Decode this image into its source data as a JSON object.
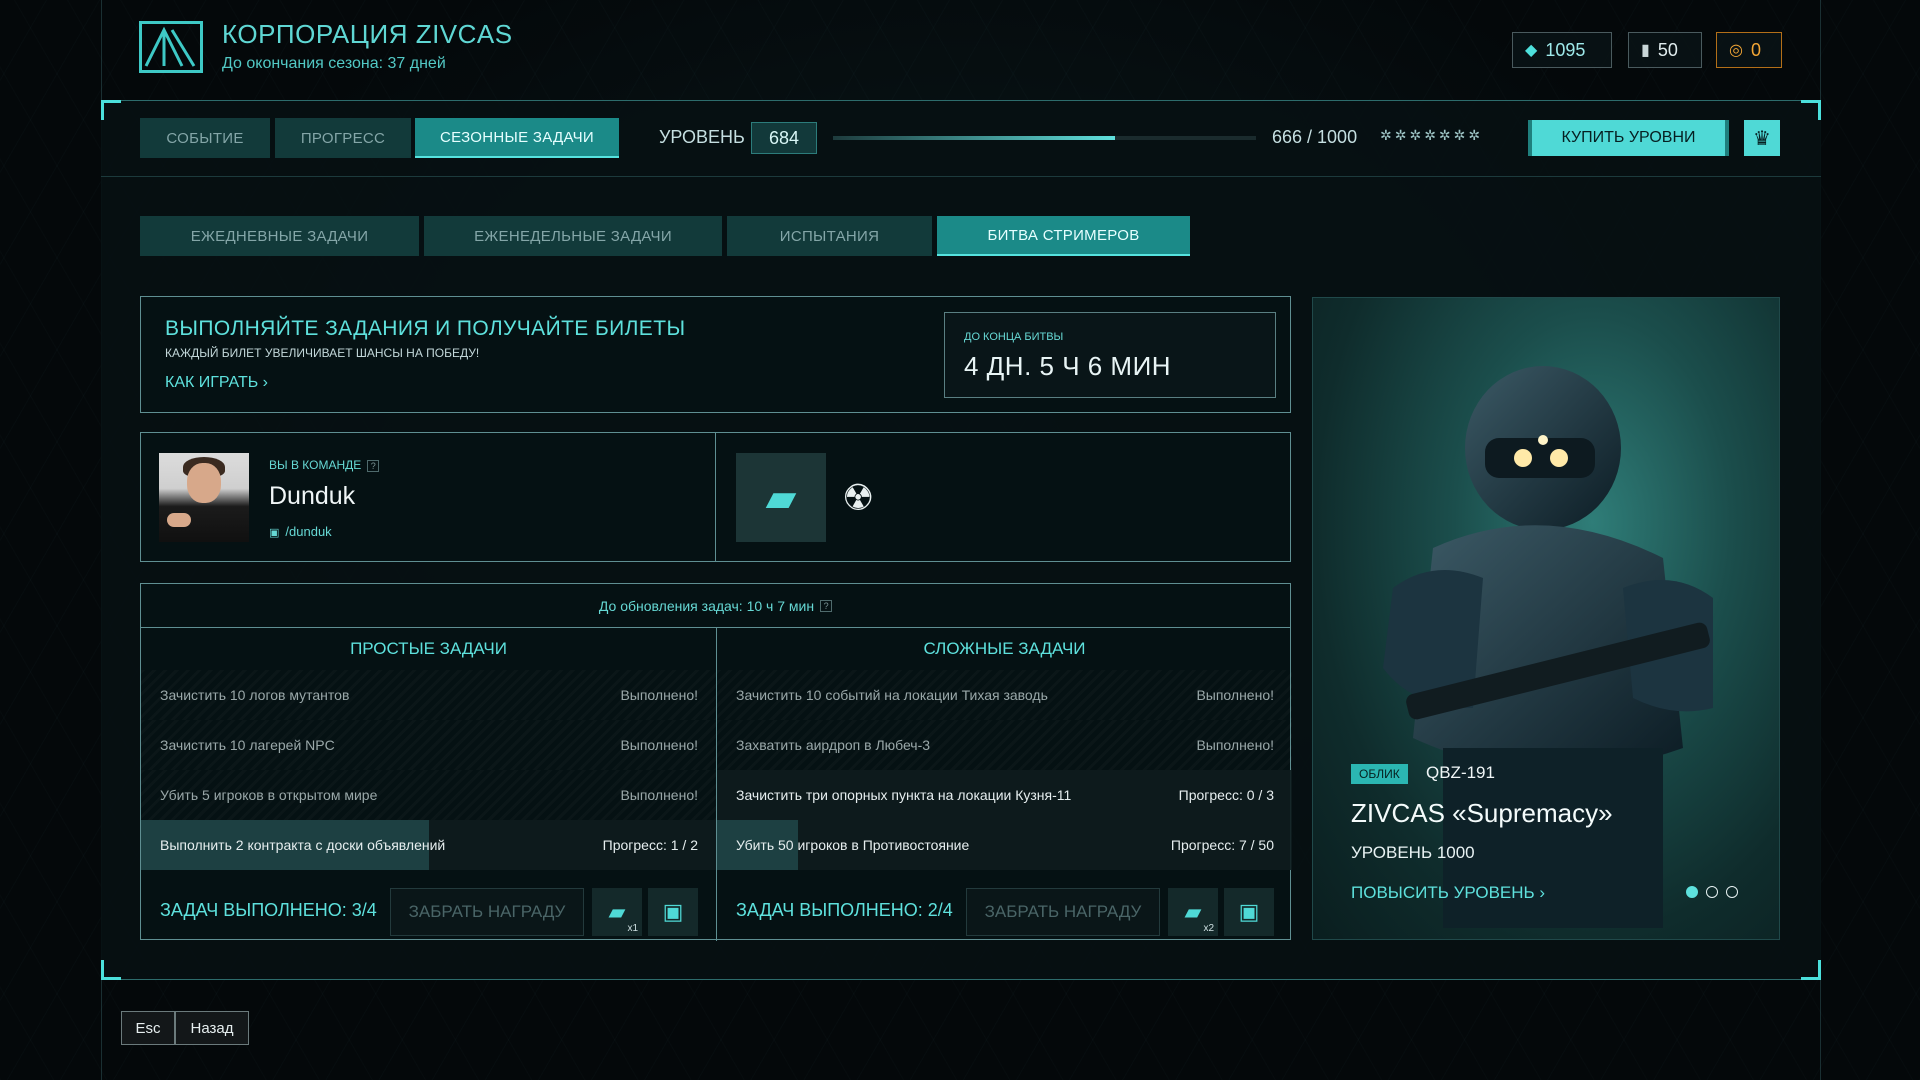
{
  "header": {
    "title": "КОРПОРАЦИЯ ZIVCAS",
    "season_info": "До окончания сезона: 37 дней",
    "logo_icon": "zivcas-logo-icon"
  },
  "currencies": [
    {
      "icon": "ticket-icon",
      "value": "1095"
    },
    {
      "icon": "token-icon",
      "value": "50"
    },
    {
      "icon": "coin-icon",
      "value": "0"
    }
  ],
  "main_tabs": [
    {
      "label": "СОБЫТИЕ",
      "active": false
    },
    {
      "label": "ПРОГРЕСС",
      "active": false
    },
    {
      "label": "СЕЗОННЫЕ ЗАДАЧИ",
      "active": true
    }
  ],
  "level": {
    "label": "УРОВЕНЬ",
    "value": "684",
    "progress_text": "666 / 1000",
    "progress_fraction": 0.666,
    "stars": "✲✲✲✲✲✲✲"
  },
  "buy_levels_label": "КУПИТЬ УРОВНИ",
  "crown_icon": "crown-icon",
  "sub_tabs": [
    {
      "label": "ЕЖЕДНЕВНЫЕ ЗАДАЧИ",
      "active": false
    },
    {
      "label": "ЕЖЕНЕДЕЛЬНЫЕ ЗАДАЧИ",
      "active": false
    },
    {
      "label": "ИСПЫТАНИЯ",
      "active": false
    },
    {
      "label": "БИТВА СТРИМЕРОВ",
      "active": true
    }
  ],
  "banner": {
    "title": "ВЫПОЛНЯЙТЕ ЗАДАНИЯ И ПОЛУЧАЙТЕ БИЛЕТЫ",
    "subtitle": "КАЖДЫЙ БИЛЕТ УВЕЛИЧИВАЕТ ШАНСЫ НА ПОБЕДУ!",
    "how_to_play": "КАК ИГРАТЬ ›",
    "timer_label": "ДО КОНЦА БИТВЫ",
    "timer_value": "4 ДН. 5 Ч 6 МИН"
  },
  "team": {
    "label": "ВЫ В КОМАНДЕ",
    "help": "?",
    "streamer_name": "Dunduk",
    "streamer_link": "/dunduk",
    "ticket_icon": "ticket-icon",
    "radiation_icon": "☢"
  },
  "tasks": {
    "refresh_timer": "До обновления задач: 10 ч 7 мин",
    "help": "?",
    "simple": {
      "title": "ПРОСТЫЕ ЗАДАЧИ",
      "rows": [
        {
          "text": "Зачистить 10 логов мутантов",
          "status": "Выполнено!",
          "done": true
        },
        {
          "text": "Зачистить 10 лагерей NPC",
          "status": "Выполнено!",
          "done": true
        },
        {
          "text": "Убить 5 игроков в открытом мире",
          "status": "Выполнено!",
          "done": true
        },
        {
          "text": "Выполнить 2 контракта с доски объявлений",
          "status": "Прогресс: 1 / 2",
          "done": false,
          "fraction": 0.5
        }
      ],
      "completed": "ЗАДАЧ ВЫПОЛНЕНО: 3/4",
      "claim": "ЗАБРАТЬ НАГРАДУ",
      "reward_multiplier": "x1"
    },
    "hard": {
      "title": "СЛОЖНЫЕ ЗАДАЧИ",
      "rows": [
        {
          "text": "Зачистить 10 событий на локации Тихая заводь",
          "status": "Выполнено!",
          "done": true
        },
        {
          "text": "Захватить аирдроп в Любеч-3",
          "status": "Выполнено!",
          "done": true
        },
        {
          "text": "Зачистить три опорных пункта на локации Кузня-11",
          "status": "Прогресс: 0 / 3",
          "done": false,
          "fraction": 0
        },
        {
          "text": "Убить 50 игроков в Противостояние",
          "status": "Прогресс: 7 / 50",
          "done": false,
          "fraction": 0.14
        }
      ],
      "completed": "ЗАДАЧ ВЫПОЛНЕНО: 2/4",
      "claim": "ЗАБРАТЬ НАГРАДУ",
      "reward_multiplier": "x2"
    }
  },
  "skin": {
    "type": "ОБЛИК",
    "weapon": "QBZ-191",
    "name": "ZIVCAS «Supremacy»",
    "level": "УРОВЕНЬ 1000",
    "upgrade": "ПОВЫСИТЬ УРОВЕНЬ ›",
    "slides": 3,
    "active_slide": 0
  },
  "footer": {
    "esc": "Esc",
    "back": "Назад"
  }
}
